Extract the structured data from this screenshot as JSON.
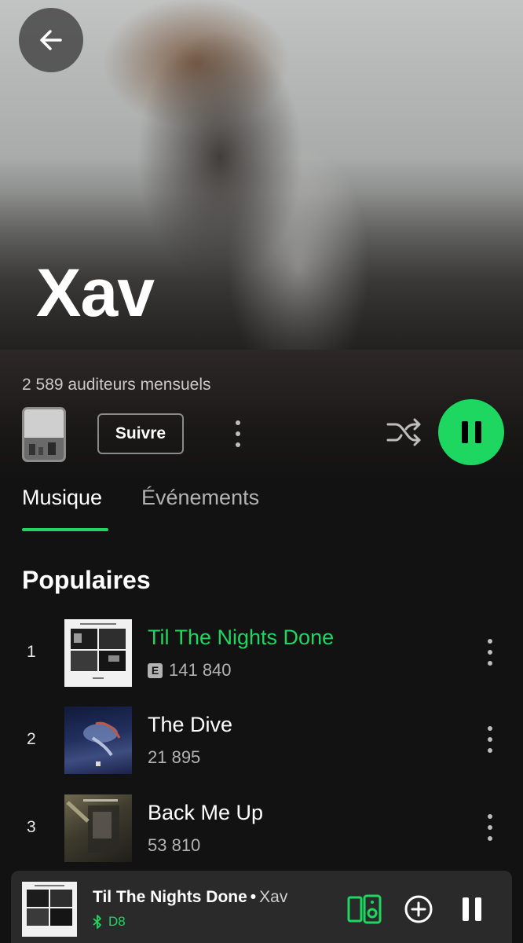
{
  "artist": {
    "name": "Xav",
    "monthly_listeners": "2 589 auditeurs mensuels"
  },
  "actions": {
    "follow_label": "Suivre"
  },
  "tabs": [
    {
      "label": "Musique",
      "active": true
    },
    {
      "label": "Événements",
      "active": false
    }
  ],
  "popular": {
    "title": "Populaires",
    "tracks": [
      {
        "number": "1",
        "title": "Til The Nights Done",
        "plays": "141 840",
        "explicit": true,
        "playing": true
      },
      {
        "number": "2",
        "title": "The Dive",
        "plays": "21 895",
        "explicit": false,
        "playing": false
      },
      {
        "number": "3",
        "title": "Back Me Up",
        "plays": "53 810",
        "explicit": false,
        "playing": false
      }
    ]
  },
  "explicit_badge": "E",
  "now_playing": {
    "title": "Til The Nights Done",
    "separator": "•",
    "artist": "Xav",
    "device": "D8"
  },
  "colors": {
    "accent": "#1ed760",
    "background": "#121212",
    "miniplayer": "#2a2a2a"
  },
  "icons": [
    "back-arrow-icon",
    "more-vert-icon",
    "shuffle-icon",
    "pause-icon",
    "explicit-icon",
    "bluetooth-icon",
    "devices-icon",
    "add-circle-icon"
  ]
}
